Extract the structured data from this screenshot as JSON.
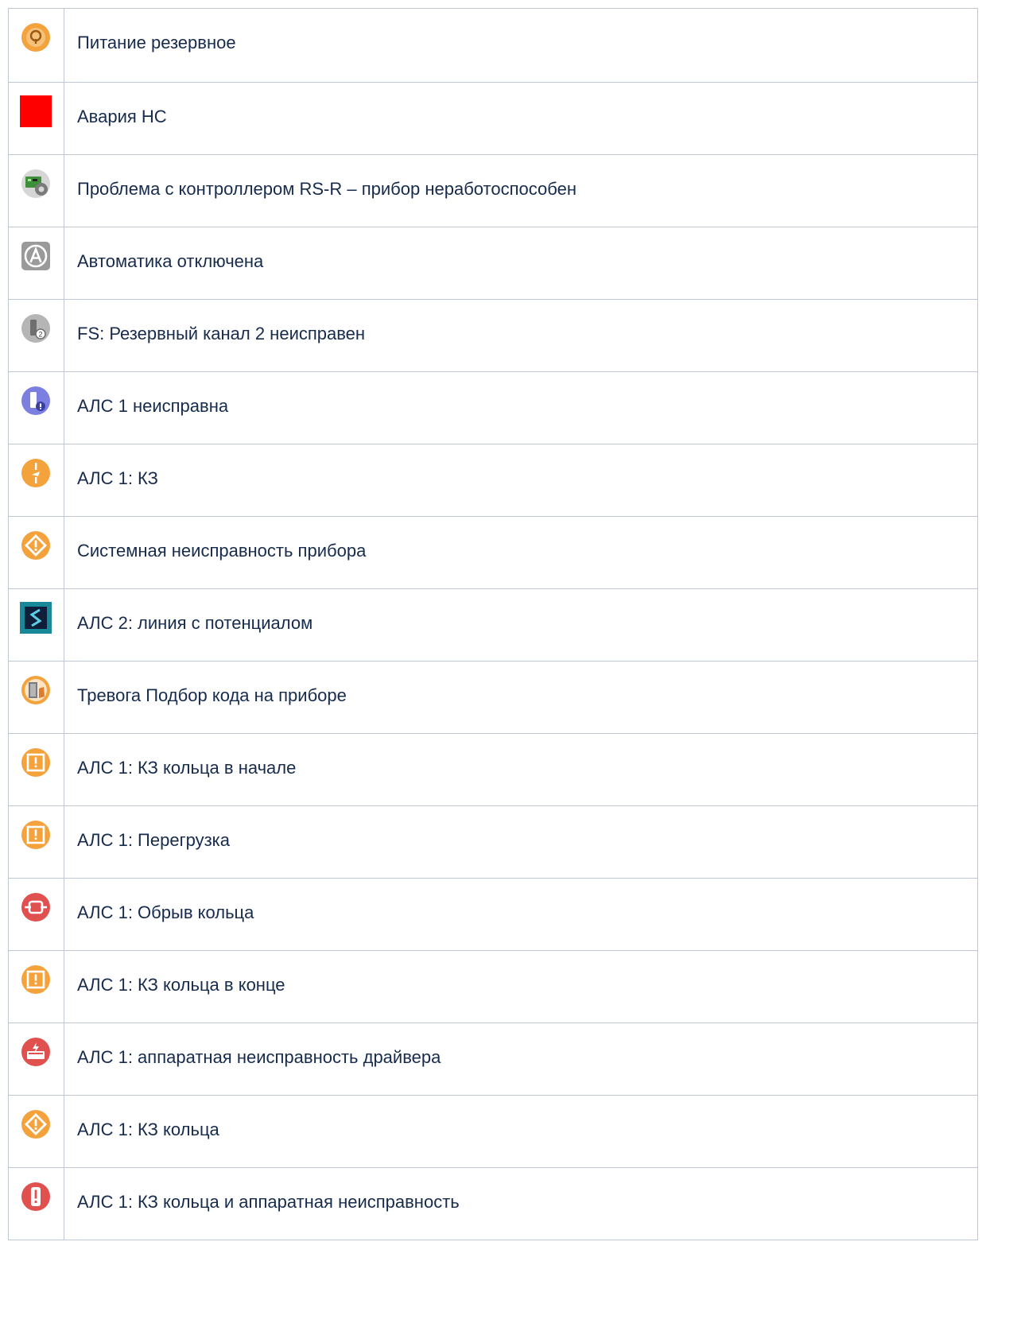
{
  "rows": [
    {
      "label": "Питание резервное",
      "icon": "backup-power-icon",
      "color": "#f3a23c"
    },
    {
      "label": "Авария НС",
      "icon": "pump-failure-icon",
      "color": "#ff0000"
    },
    {
      "label": "Проблема с контроллером RS-R – прибор неработоспособен",
      "icon": "controller-problem-icon",
      "color": "#3f8f3a"
    },
    {
      "label": "Автоматика отключена",
      "icon": "automation-off-icon",
      "color": "#9a9a9a"
    },
    {
      "label": "FS: Резервный канал 2 неисправен",
      "icon": "backup-channel-fault-icon",
      "color": "#b5b5b5"
    },
    {
      "label": "АЛС 1 неисправна",
      "icon": "als-fault-icon",
      "color": "#7b7fe0"
    },
    {
      "label": "АЛС 1: КЗ",
      "icon": "als-short-circuit-icon",
      "color": "#f3a23c"
    },
    {
      "label": "Системная неисправность прибора",
      "icon": "system-fault-icon",
      "color": "#f3a23c"
    },
    {
      "label": "АЛС 2: линия с потенциалом",
      "icon": "line-potential-icon",
      "color": "#19899a"
    },
    {
      "label": "Тревога Подбор кода на приборе",
      "icon": "code-guessing-alarm-icon",
      "color": "#f3a23c"
    },
    {
      "label": "АЛС 1: КЗ кольца в начале",
      "icon": "ring-short-start-icon",
      "color": "#f3a23c"
    },
    {
      "label": "АЛС 1: Перегрузка",
      "icon": "overload-icon",
      "color": "#f3a23c"
    },
    {
      "label": "АЛС 1: Обрыв кольца",
      "icon": "ring-break-icon",
      "color": "#e0504f"
    },
    {
      "label": "АЛС 1: КЗ кольца в конце",
      "icon": "ring-short-end-icon",
      "color": "#f3a23c"
    },
    {
      "label": "АЛС 1: аппаратная неисправность драйвера",
      "icon": "driver-hardware-fault-icon",
      "color": "#e0504f"
    },
    {
      "label": "АЛС 1: КЗ кольца",
      "icon": "ring-short-icon",
      "color": "#f3a23c"
    },
    {
      "label": "АЛС 1: КЗ кольца и аппаратная неисправность",
      "icon": "ring-short-hardware-fault-icon",
      "color": "#e0504f"
    }
  ]
}
